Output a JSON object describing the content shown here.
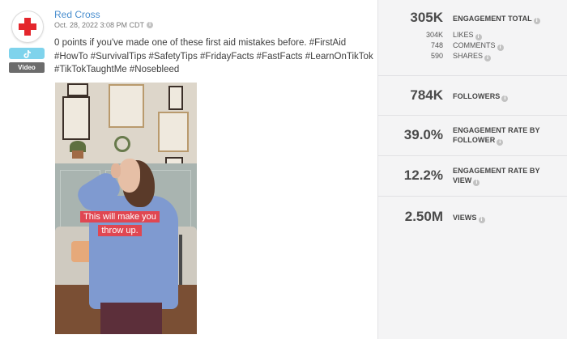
{
  "post": {
    "author": "Red Cross",
    "timestamp": "Oct. 28, 2022 3:08 PM CDT",
    "network_badge": "tiktok-icon",
    "media_type": "Video",
    "caption": "0 points if you've made one of these first aid mistakes before. #FirstAid #HowTo #SurvivalTips #SafetyTips #FridayFacts #FastFacts #LearnOnTikTok #TikTokTaughtMe #Nosebleed",
    "video_overlay_text": "This will make you throw up."
  },
  "stats": {
    "engagement_total": {
      "value": "305K",
      "label": "ENGAGEMENT TOTAL"
    },
    "breakdown": [
      {
        "value": "304K",
        "label": "LIKES"
      },
      {
        "value": "748",
        "label": "COMMENTS"
      },
      {
        "value": "590",
        "label": "SHARES"
      }
    ],
    "followers": {
      "value": "784K",
      "label": "FOLLOWERS"
    },
    "engagement_rate_follower": {
      "value": "39.0%",
      "label_line1": "ENGAGEMENT RATE BY",
      "label_line2": "FOLLOWER"
    },
    "engagement_rate_view": {
      "value": "12.2%",
      "label_line1": "ENGAGEMENT RATE BY",
      "label_line2": "VIEW"
    },
    "views": {
      "value": "2.50M",
      "label": "VIEWS"
    }
  },
  "colors": {
    "brand_red": "#e4262c",
    "author_link": "#4a8fcf",
    "tiktok_badge": "#7fd3ec",
    "stats_bg": "#f4f4f5"
  }
}
